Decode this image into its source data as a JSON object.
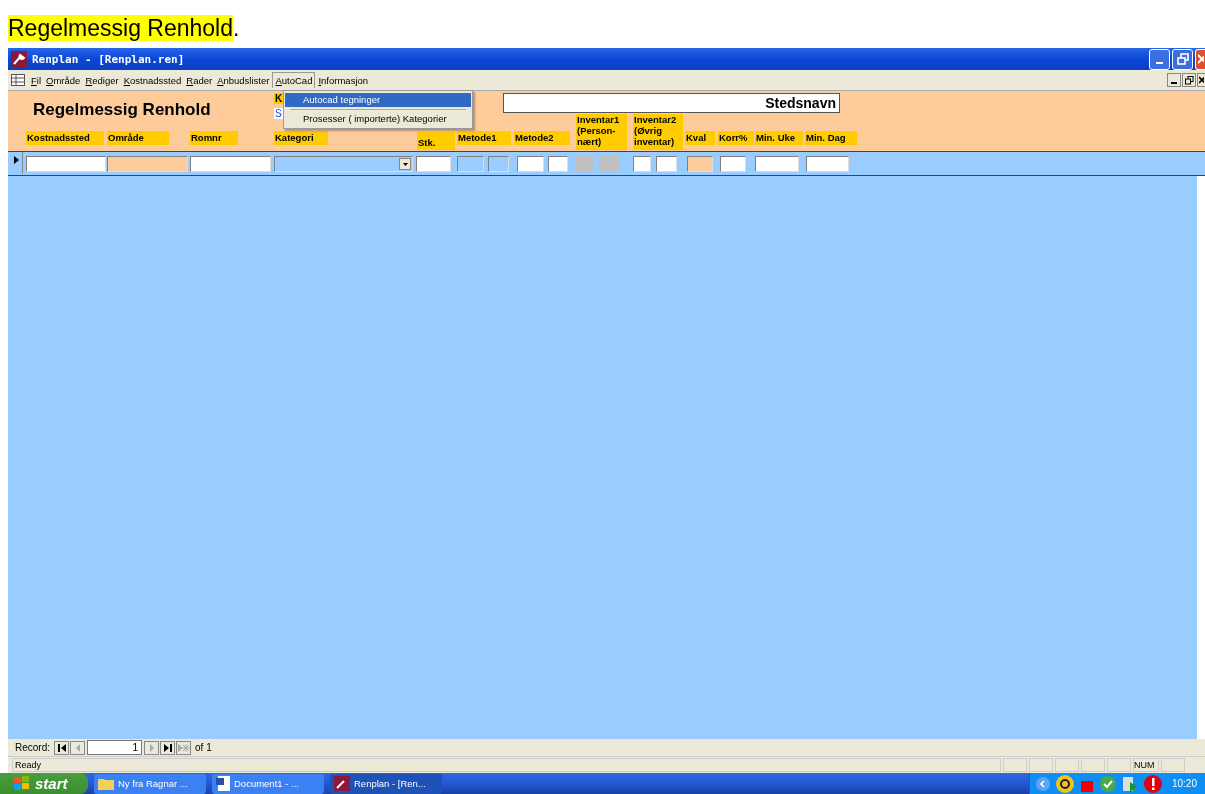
{
  "page_heading": {
    "text": "Regelmessig Renhold",
    "trailing": "."
  },
  "window": {
    "title": "Renplan - [Renplan.ren]"
  },
  "menu_bar": {
    "items": [
      {
        "label": "Fil",
        "selected": false
      },
      {
        "label": "Område",
        "selected": false
      },
      {
        "label": "Rediger",
        "selected": false
      },
      {
        "label": "Kostnadssted",
        "selected": false
      },
      {
        "label": "Rader",
        "selected": false
      },
      {
        "label": "Anbudslister",
        "selected": false
      },
      {
        "label": "AutoCad",
        "selected": true
      },
      {
        "label": "Informasjon",
        "selected": false
      }
    ]
  },
  "dropdown_menu": {
    "items": [
      {
        "kind": "item",
        "label": "Autocad tegninger",
        "selected": true
      },
      {
        "kind": "separator"
      },
      {
        "kind": "item",
        "label": "Prosesser ( importerte) Kategorier",
        "selected": false
      }
    ]
  },
  "form_header": {
    "title": "Regelmessig Renhold",
    "partial_label_1": "K",
    "partial_label_2": "S",
    "place_name": "Stedsnavn",
    "column_labels": [
      {
        "text": "Kostnadssted"
      },
      {
        "text": "Område"
      },
      {
        "text": "Romnr"
      },
      {
        "text": "Kategori"
      },
      {
        "text": "Stk."
      },
      {
        "text": "Metode1"
      },
      {
        "text": "Metode2"
      },
      {
        "text": "Inventar1 (Person-nært)"
      },
      {
        "text": "Inventar2 (Øvrig inventar)"
      },
      {
        "text": "Kval"
      },
      {
        "text": "Korr%"
      },
      {
        "text": "Min. Uke"
      },
      {
        "text": "Min. Dag"
      }
    ]
  },
  "detail_row": {
    "fields": [
      {
        "kind": "text"
      },
      {
        "kind": "locked"
      },
      {
        "kind": "text"
      },
      {
        "kind": "combo"
      },
      {
        "kind": "text"
      },
      {
        "kind": "blue"
      },
      {
        "kind": "blue"
      },
      {
        "kind": "text"
      },
      {
        "kind": "text"
      },
      {
        "kind": "disabled"
      },
      {
        "kind": "disabled"
      },
      {
        "kind": "text"
      },
      {
        "kind": "text"
      },
      {
        "kind": "locked"
      },
      {
        "kind": "text"
      },
      {
        "kind": "text"
      },
      {
        "kind": "text"
      }
    ]
  },
  "record_navigator": {
    "label": "Record:",
    "current": "1",
    "total": "of 1"
  },
  "status_bar": {
    "text": "Ready",
    "indicator": "NUM"
  },
  "taskbar": {
    "start": "start",
    "tasks": [
      {
        "label": "Ny fra Ragnar ...",
        "selected": false
      },
      {
        "label": "Document1 - ...",
        "selected": false
      },
      {
        "label": "Renplan - [Ren...",
        "selected": true
      }
    ],
    "clock": "10:20"
  }
}
